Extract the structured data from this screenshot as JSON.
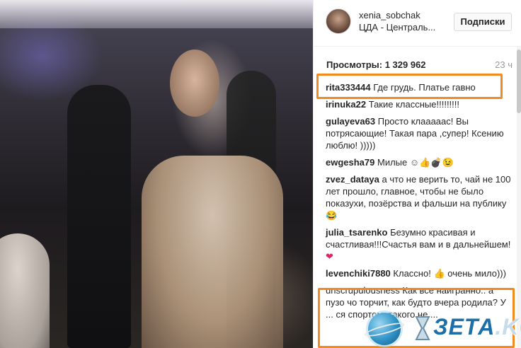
{
  "post": {
    "username": "xenia_sobchak",
    "location": "ЦДА - Централь...",
    "follow_label": "Подписки",
    "views_label": "Просмотры: 1 329 962",
    "time": "23 ч"
  },
  "comments": [
    {
      "user": "rita333444",
      "text": "Где грудь. Платье гавно"
    },
    {
      "user": "irinuka22",
      "text": "Такие классные!!!!!!!!!"
    },
    {
      "user": "gulayeva63",
      "text": "Просто клааааас! Вы потрясающие! Такая пара ,супер! Ксению люблю! )))))"
    },
    {
      "user": "ewgesha79",
      "text": "Милые",
      "emoji": "☺👍💣😉"
    },
    {
      "user": "zvez_dataya",
      "text": "а что не верить то, чай не 100 лет прошло, главное, чтобы не было показухи, позёрства и фальши на публику",
      "emoji": "😂"
    },
    {
      "user": "julia_tsarenko",
      "text": "Безумно красивая и счастливая!!!Счастья вам и в дальнейшем!",
      "emoji": "❤"
    },
    {
      "user": "levenchiki7880",
      "text": "Классно!",
      "emoji": "👍",
      "text_after": "очень мило)))"
    },
    {
      "user": "unscrupulousness",
      "text": "Как все наигранно.. а пузо чо торчит, как будто вчера родила? У ... ся спортом, такого не ..."
    }
  ],
  "watermark": {
    "text": "ЗЕТА",
    "suffix": ".KG"
  },
  "colors": {
    "highlight": "#f28a1e",
    "watermark_blue": "#1d6fa8"
  }
}
